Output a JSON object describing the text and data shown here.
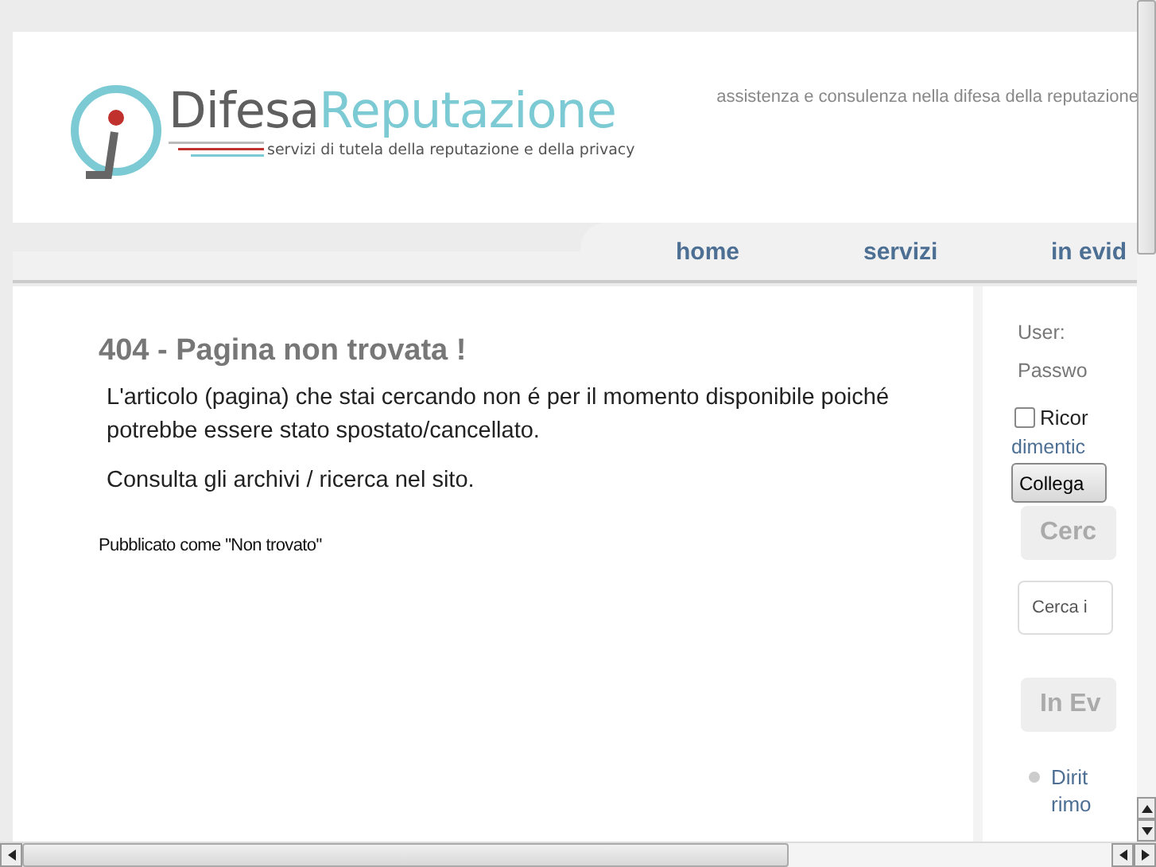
{
  "header": {
    "logo": {
      "first": "Difesa",
      "second": "Reputazione",
      "subtitle": "servizi di tutela della reputazione e della privacy"
    },
    "tagline": "assistenza e consulenza nella difesa della reputazione"
  },
  "nav": [
    {
      "label": "home"
    },
    {
      "label": "servizi"
    },
    {
      "label": "in evid"
    }
  ],
  "article": {
    "title": "404 - Pagina non trovata !",
    "paragraphs": [
      "L'articolo (pagina) che stai cercando non é per il momento disponibile poiché potrebbe essere stato spostato/cancellato.",
      "Consulta gli archivi / ricerca nel sito."
    ],
    "meta": "Pubblicato come \"Non trovato\""
  },
  "sidebar": {
    "login": {
      "user_label": "User:",
      "password_label": "Passwo",
      "remember": {
        "label": "Ricor",
        "checked": false
      },
      "forgot_link": "dimentic",
      "submit": "Collega"
    },
    "search_heading": "Cerc",
    "search": {
      "placeholder": "Cerca i"
    },
    "featured_heading": "In Ev",
    "featured": [
      {
        "lines": [
          "Dirit",
          "rimo"
        ]
      }
    ]
  }
}
